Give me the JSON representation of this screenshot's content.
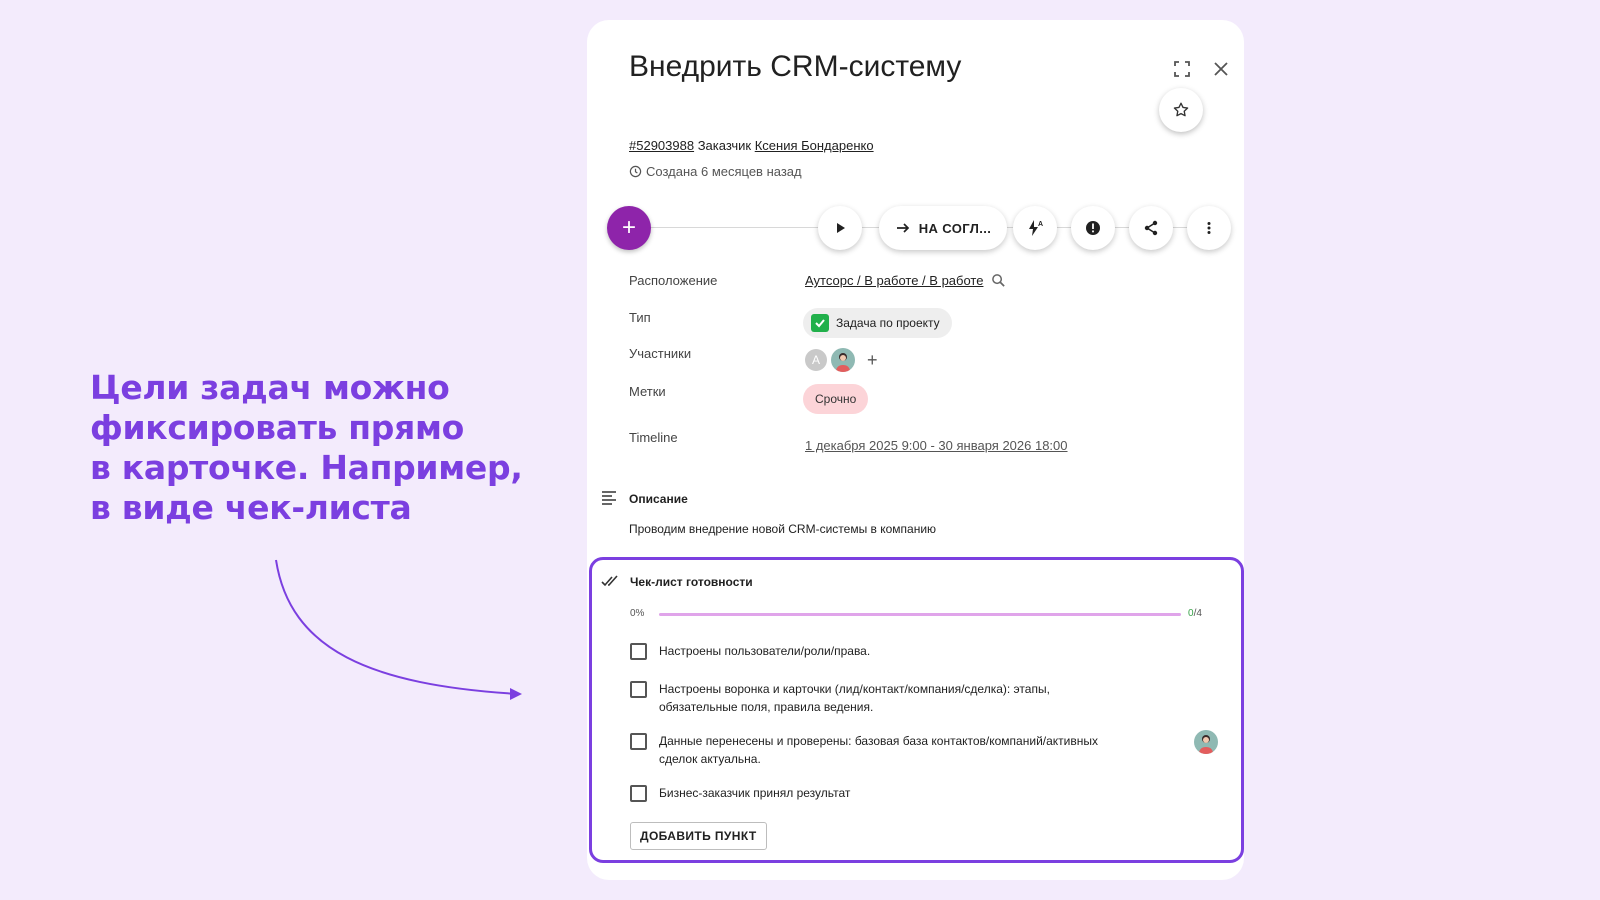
{
  "promo": {
    "lines": [
      "Цели задач можно",
      "фиксировать прямо",
      "в карточке. Например,",
      "в виде чек-листа"
    ]
  },
  "task": {
    "title": "Внедрить CRM-систему",
    "id": "#52903988",
    "customer_label": "Заказчик",
    "customer_name": "Ксения Бондаренко",
    "created": "Создана 6 месяцев назад"
  },
  "toolbar": {
    "add_label": "+",
    "status_button": "НА СОГЛ..."
  },
  "fields": {
    "location_label": "Расположение",
    "location_value": "Аутсорс / В работе / В работе",
    "type_label": "Тип",
    "type_value": "Задача по проекту",
    "participants_label": "Участники",
    "participant_initial": "A",
    "tags_label": "Метки",
    "tag_value": "Срочно",
    "timeline_label": "Timeline",
    "timeline_value": "1 декабря 2025 9:00 - 30 января 2026 18:00"
  },
  "description": {
    "heading": "Описание",
    "text": "Проводим внедрение новой CRM-системы в компанию"
  },
  "checklist": {
    "title": "Чек-лист готовности",
    "percent_label": "0%",
    "progress": 0,
    "done": "0",
    "total": "/4",
    "items": [
      {
        "line1": "Настроены пользователи/роли/права.",
        "line2": ""
      },
      {
        "line1": "Настроены воронка и карточки (лид/контакт/компания/сделка): этапы,",
        "line2": "обязательные поля, правила ведения."
      },
      {
        "line1": "Данные перенесены и проверены: базовая база контактов/компаний/активных",
        "line2": "сделок актуальна."
      },
      {
        "line1": "Бизнес-заказчик принял результат",
        "line2": ""
      }
    ],
    "add_button": "ДОБАВИТЬ ПУНКТ"
  },
  "colors": {
    "accent": "#7b3fe0",
    "fab": "#8e24aa",
    "progress_track": "#e0a4ea",
    "tag_bg": "#fcd4d8",
    "background": "#f3ebfc"
  },
  "icons": [
    "expand-icon",
    "close-icon",
    "star-icon",
    "clock-icon",
    "play-icon",
    "arrow-right-icon",
    "lightning-icon",
    "alert-icon",
    "share-icon",
    "more-vertical-icon",
    "search-icon",
    "check-square-icon",
    "description-icon",
    "double-check-icon"
  ]
}
